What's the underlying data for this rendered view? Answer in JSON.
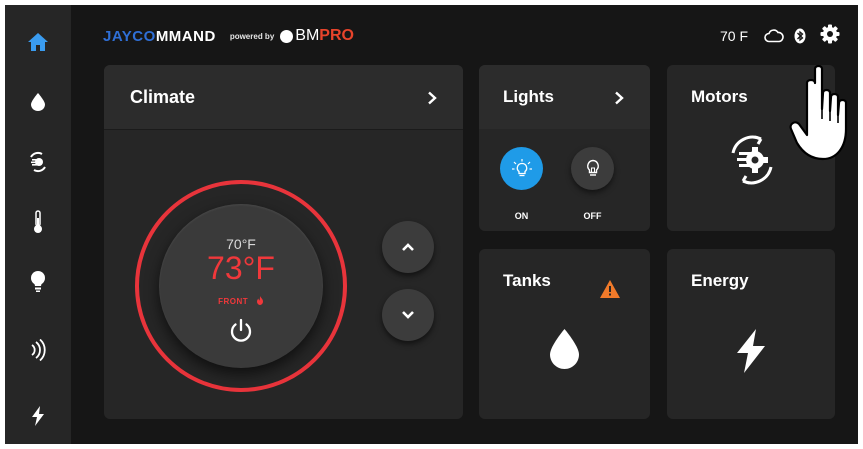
{
  "header": {
    "brand_jayco": "JAYC",
    "brand_o": "O",
    "brand_command": "MMAND",
    "powered_by": "powered by",
    "bm": "BM",
    "pro": "PRO",
    "outside_temp": "70 F",
    "icons": [
      "cloud-icon",
      "bluetooth-icon",
      "gear-icon"
    ]
  },
  "sidebar": {
    "items": [
      {
        "name": "home",
        "icon": "home-icon",
        "active": true
      },
      {
        "name": "water",
        "icon": "water-drop-icon"
      },
      {
        "name": "motors",
        "icon": "motor-gear-icon"
      },
      {
        "name": "climate",
        "icon": "thermometer-icon"
      },
      {
        "name": "lights",
        "icon": "lightbulb-icon"
      },
      {
        "name": "signal",
        "icon": "signal-waves-icon"
      },
      {
        "name": "energy",
        "icon": "lightning-icon"
      }
    ]
  },
  "climate": {
    "title": "Climate",
    "current_temp": "70°F",
    "set_temp": "73°F",
    "zone": "FRONT",
    "mode_icon": "flame-icon"
  },
  "lights": {
    "title": "Lights",
    "on_label": "ON",
    "off_label": "OFF"
  },
  "motors": {
    "title": "Motors"
  },
  "tanks": {
    "title": "Tanks",
    "alert_icon": "warning-icon"
  },
  "energy": {
    "title": "Energy"
  },
  "colors": {
    "background": "#161616",
    "card": "#262626",
    "accent_red": "#e8343b",
    "accent_blue": "#1f9be8",
    "warning": "#f07a2a"
  }
}
